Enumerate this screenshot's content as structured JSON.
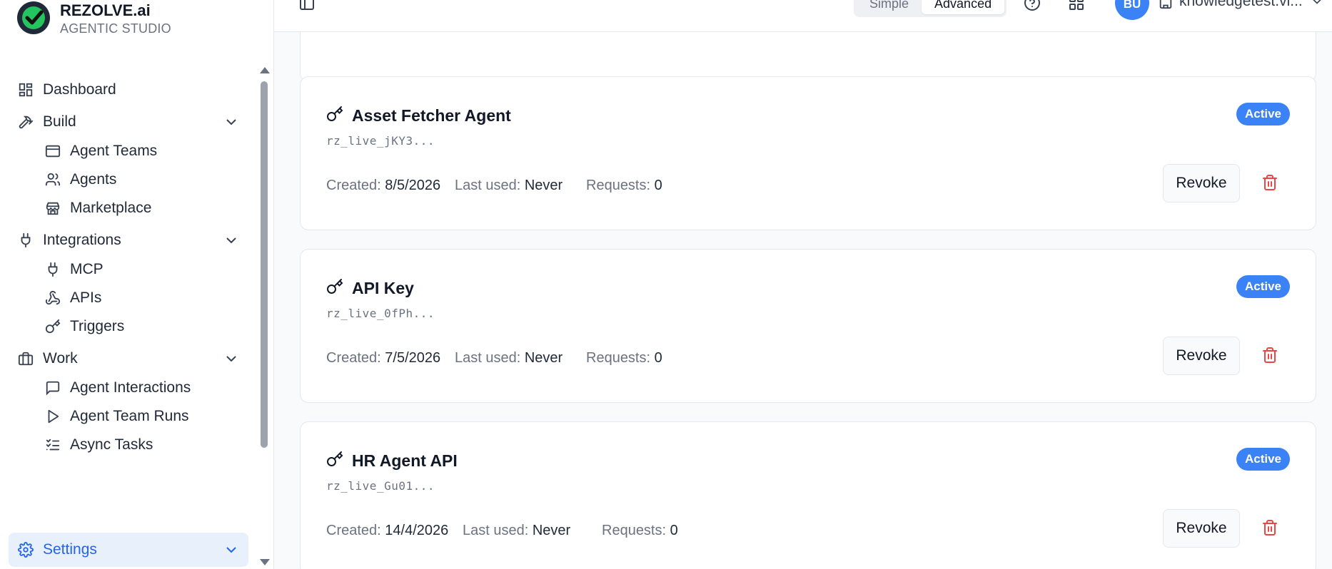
{
  "brand": {
    "name": "REZOLVE.ai",
    "subtitle": "AGENTIC STUDIO"
  },
  "sidebar": {
    "items": [
      {
        "label": "Dashboard",
        "icon": "dashboard-icon"
      },
      {
        "label": "Build",
        "icon": "hammer-icon",
        "expandable": true
      },
      {
        "label": "Agent Teams",
        "icon": "browser-window-icon"
      },
      {
        "label": "Agents",
        "icon": "users-icon"
      },
      {
        "label": "Marketplace",
        "icon": "store-icon"
      },
      {
        "label": "Integrations",
        "icon": "plug-icon",
        "expandable": true
      },
      {
        "label": "MCP",
        "icon": "plug-icon"
      },
      {
        "label": "APIs",
        "icon": "webhook-icon"
      },
      {
        "label": "Triggers",
        "icon": "key-icon"
      },
      {
        "label": "Work",
        "icon": "briefcase-icon",
        "expandable": true
      },
      {
        "label": "Agent Interactions",
        "icon": "message-square-icon"
      },
      {
        "label": "Agent Team Runs",
        "icon": "play-icon"
      },
      {
        "label": "Async Tasks",
        "icon": "list-checks-icon"
      },
      {
        "label": "Settings",
        "icon": "gear-icon",
        "expandable": true,
        "active": true
      }
    ]
  },
  "topbar": {
    "mode": {
      "simple": "Simple",
      "advanced": "Advanced",
      "selected": "Advanced"
    },
    "avatar_initials": "BU",
    "tenant": "knowledgetest.vi..."
  },
  "api_keys": [
    {
      "name": "Asset Fetcher Agent",
      "prefix": "rz_live_jKY3...",
      "status": "Active",
      "created_label": "Created:",
      "created": "8/5/2026",
      "last_used_label": "Last used:",
      "last_used": "Never",
      "requests_label": "Requests:",
      "requests": "0",
      "revoke_label": "Revoke"
    },
    {
      "name": "API Key",
      "prefix": "rz_live_0fPh...",
      "status": "Active",
      "created_label": "Created:",
      "created": "7/5/2026",
      "last_used_label": "Last used:",
      "last_used": "Never",
      "requests_label": "Requests:",
      "requests": "0",
      "revoke_label": "Revoke"
    },
    {
      "name": "HR Agent API",
      "prefix": "rz_live_Gu01...",
      "status": "Active",
      "created_label": "Created:",
      "created": "14/4/2026",
      "last_used_label": "Last used:",
      "last_used": "Never",
      "requests_label": "Requests:",
      "requests": "0",
      "revoke_label": "Revoke"
    }
  ],
  "colors": {
    "accent": "#3b82f6",
    "active_nav_bg": "#e8f0fc",
    "danger": "#ef4444"
  }
}
